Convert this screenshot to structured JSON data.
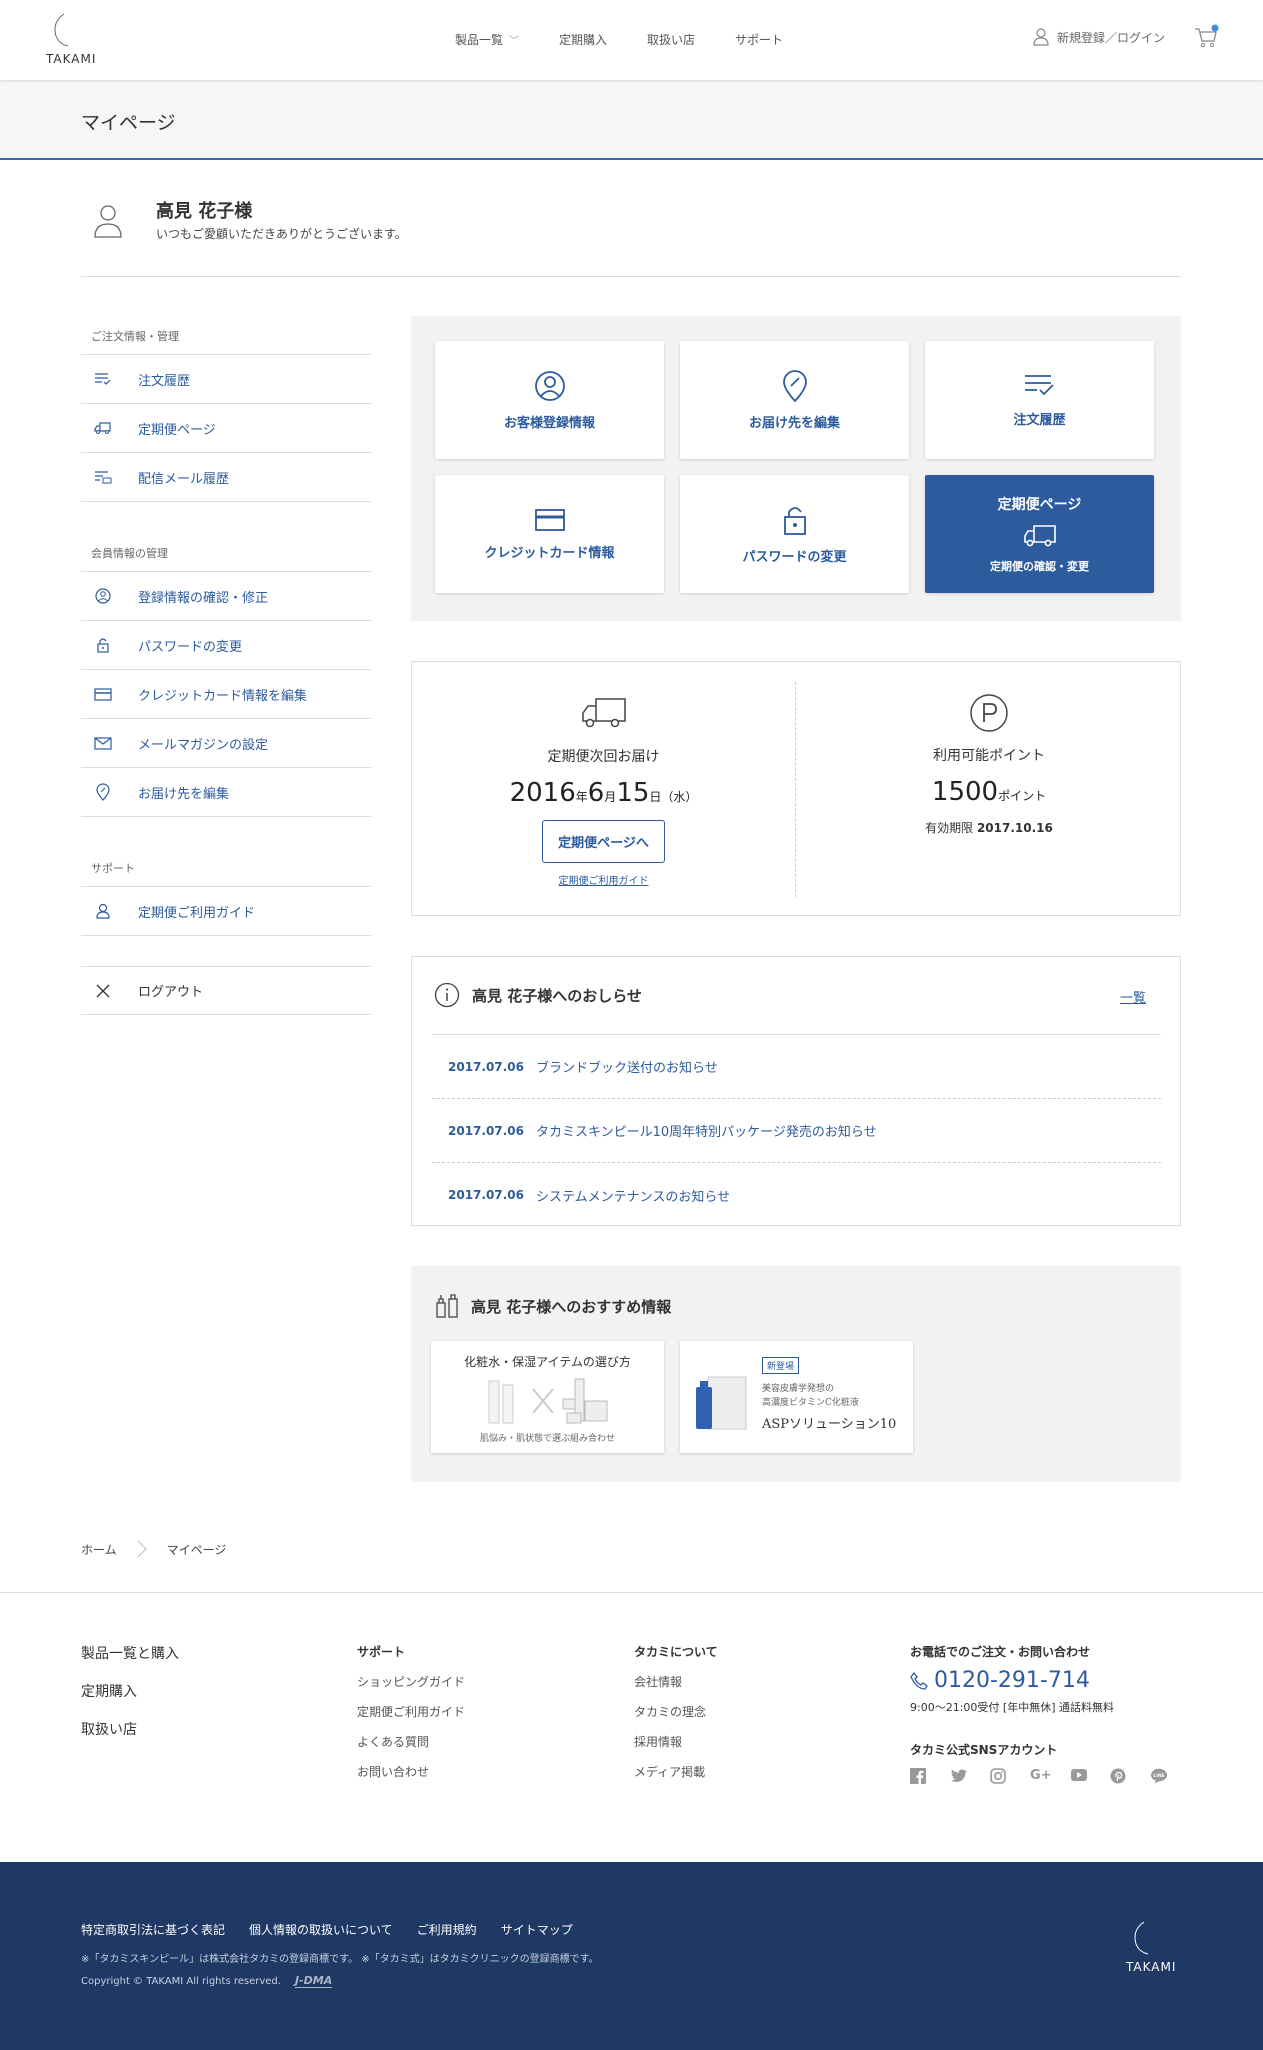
{
  "header": {
    "logo_text": "TAKAMI",
    "nav": [
      "製品一覧",
      "定期購入",
      "取扱い店",
      "サポート"
    ],
    "login_label": "新規登録／ログイン"
  },
  "page_title": "マイページ",
  "greeting": {
    "name": "高見 花子様",
    "message": "いつもご愛顧いただきありがとうございます。"
  },
  "sidebar": {
    "order_heading": "ご注文情報・管理",
    "order_items": [
      "注文履歴",
      "定期便ページ",
      "配信メール履歴"
    ],
    "member_heading": "会員情報の管理",
    "member_items": [
      "登録情報の確認・修正",
      "パスワードの変更",
      "クレジットカード情報を編集",
      "メールマガジンの設定",
      "お届け先を編集"
    ],
    "support_heading": "サポート",
    "support_items": [
      "定期便ご利用ガイド"
    ],
    "logout_label": "ログアウト"
  },
  "tiles": {
    "customer": "お客様登録情報",
    "address": "お届け先を編集",
    "orders": "注文履歴",
    "card": "クレジットカード情報",
    "password": "パスワードの変更",
    "subscription_title": "定期便ページ",
    "subscription_sub": "定期便の確認・変更"
  },
  "delivery": {
    "label": "定期便次回お届け",
    "year": "2016",
    "year_unit": "年",
    "month": "6",
    "month_unit": "月",
    "day": "15",
    "day_unit": "日",
    "weekday": "（水）",
    "button": "定期便ページへ",
    "guide_link": "定期便ご利用ガイド"
  },
  "points": {
    "label": "利用可能ポイント",
    "value": "1500",
    "unit": "ポイント",
    "expiry_label": "有効期限",
    "expiry_date": "2017.10.16"
  },
  "news": {
    "title": "高見 花子様へのおしらせ",
    "more": "一覧",
    "items": [
      {
        "date": "2017.07.06",
        "text": "ブランドブック送付のお知らせ"
      },
      {
        "date": "2017.07.06",
        "text": "タカミスキンピール10周年特別パッケージ発売のお知らせ"
      },
      {
        "date": "2017.07.06",
        "text": "システムメンテナンスのお知らせ"
      }
    ]
  },
  "recommend": {
    "title": "高見 花子様へのおすすめ情報",
    "card1_title": "化粧水・保湿アイテムの選び方",
    "card1_sub": "肌悩み・肌状態で選ぶ組み合わせ",
    "card2_badge": "新登場",
    "card2_line1": "美容皮膚学発想の",
    "card2_line2": "高濃度ビタミンC化粧液",
    "card2_name": "ASPソリューション10"
  },
  "breadcrumb": [
    "ホーム",
    "マイページ"
  ],
  "footer": {
    "main_links": [
      "製品一覧と購入",
      "定期購入",
      "取扱い店"
    ],
    "support_heading": "サポート",
    "support_links": [
      "ショッピングガイド",
      "定期便ご利用ガイド",
      "よくある質問",
      "お問い合わせ"
    ],
    "about_heading": "タカミについて",
    "about_links": [
      "会社情報",
      "タカミの理念",
      "採用情報",
      "メディア掲載"
    ],
    "contact_heading": "お電話でのご注文・お問い合わせ",
    "phone": "0120-291-714",
    "hours": "9:00～21:00受付 [年中無休] 通話料無料",
    "sns_heading": "タカミ公式SNSアカウント",
    "sns": [
      "facebook-icon",
      "twitter-icon",
      "instagram-icon",
      "google-plus-icon",
      "youtube-icon",
      "pinterest-icon",
      "line-icon"
    ]
  },
  "bottom": {
    "links": [
      "特定商取引法に基づく表記",
      "個人情報の取扱いについて",
      "ご利用規約",
      "サイトマップ"
    ],
    "trademark": "※「タカミスキンピール」は株式会社タカミの登録商標です。 ※「タカミ式」はタカミクリニックの登録商標です。",
    "copyright": "Copyright © TAKAMI All rights reserved.",
    "jdma": "J-DMA",
    "logo_text": "TAKAMI"
  },
  "colors": {
    "accent": "#2c5b9e",
    "footer_bg": "#1f3864"
  }
}
